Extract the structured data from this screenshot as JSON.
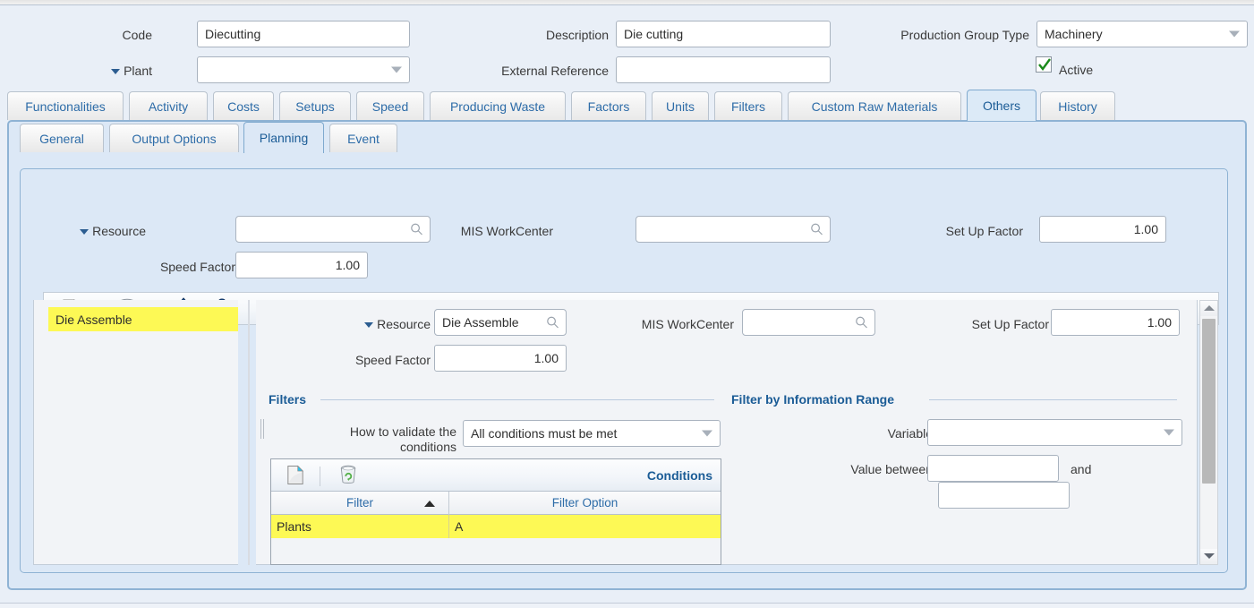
{
  "header": {
    "code_label": "Code",
    "code_value": "Diecutting",
    "plant_label": "Plant",
    "plant_value": "",
    "description_label": "Description",
    "description_value": "Die cutting",
    "external_reference_label": "External Reference",
    "external_reference_value": "",
    "production_group_type_label": "Production Group Type",
    "production_group_type_value": "Machinery",
    "active_label": "Active",
    "active_checked": "✓"
  },
  "tabs": [
    {
      "label": "Functionalities",
      "active": false
    },
    {
      "label": "Activity",
      "active": false
    },
    {
      "label": "Costs",
      "active": false
    },
    {
      "label": "Setups",
      "active": false
    },
    {
      "label": "Speed",
      "active": false
    },
    {
      "label": "Producing Waste",
      "active": false
    },
    {
      "label": "Factors",
      "active": false
    },
    {
      "label": "Units",
      "active": false
    },
    {
      "label": "Filters",
      "active": false
    },
    {
      "label": "Custom Raw Materials",
      "active": false
    },
    {
      "label": "Others",
      "active": true
    },
    {
      "label": "History",
      "active": false
    }
  ],
  "subtabs": [
    {
      "label": "General",
      "active": false
    },
    {
      "label": "Output Options",
      "active": false
    },
    {
      "label": "Planning",
      "active": true
    },
    {
      "label": "Event",
      "active": false
    }
  ],
  "planning": {
    "resource_label": "Resource",
    "resource_value": "",
    "mis_workcenter_label": "MIS WorkCenter",
    "mis_workcenter_value": "",
    "setup_factor_label": "Set Up Factor",
    "setup_factor_value": "1.00",
    "speed_factor_label": "Speed Factor",
    "speed_factor_value": "1.00"
  },
  "toolbar": {
    "new_icon": "new-document-icon",
    "delete_icon": "recycle-bin-icon",
    "move_up_icon": "arrow-up-icon",
    "move_down_icon": "arrow-down-icon"
  },
  "resource_list": {
    "items": [
      {
        "label": "Die Assemble",
        "selected": true
      }
    ]
  },
  "detail": {
    "resource_label": "Resource",
    "resource_value": "Die Assemble",
    "mis_workcenter_label": "MIS WorkCenter",
    "mis_workcenter_value": "",
    "setup_factor_label": "Set Up Factor",
    "setup_factor_value": "1.00",
    "speed_factor_label": "Speed Factor",
    "speed_factor_value": "1.00"
  },
  "filters": {
    "title": "Filters",
    "validate_label_line1": "How to validate the",
    "validate_label_line2": "conditions",
    "validate_value": "All conditions must be met",
    "grid": {
      "title": "Conditions",
      "columns": [
        "Filter",
        "Filter Option"
      ],
      "sort_column": "Filter",
      "sort_direction": "asc",
      "rows": [
        {
          "filter": "Plants",
          "filter_option": "A",
          "selected": true
        }
      ]
    }
  },
  "info_range": {
    "title": "Filter by Information Range",
    "variable_label": "Variable",
    "variable_value": "",
    "value_between_label": "Value between",
    "value_from": "",
    "and_label": "and",
    "value_to": ""
  },
  "colors": {
    "accent": "#1b5c96",
    "tab_text": "#2d6ca8",
    "panel_bg": "#dce8f6",
    "highlight": "#fdf955",
    "check_green": "#1a8a1a"
  }
}
